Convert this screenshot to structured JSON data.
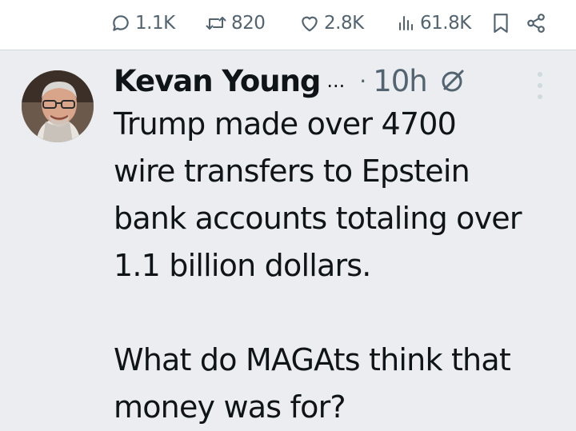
{
  "actions": {
    "replies": "1.1K",
    "reposts": "820",
    "likes": "2.8K",
    "views": "61.8K"
  },
  "post": {
    "author": "Kevan Young",
    "name_truncation": "...",
    "separator": "·",
    "time": "10h",
    "text": "Trump made over 4700\nwire transfers to Epstein\nbank accounts totaling over\n1.1 billion dollars.\n\nWhat do MAGAts think that\nmoney was for?"
  },
  "colors": {
    "background": "#ebedf0",
    "muted": "#536471",
    "text": "#0f1419"
  }
}
